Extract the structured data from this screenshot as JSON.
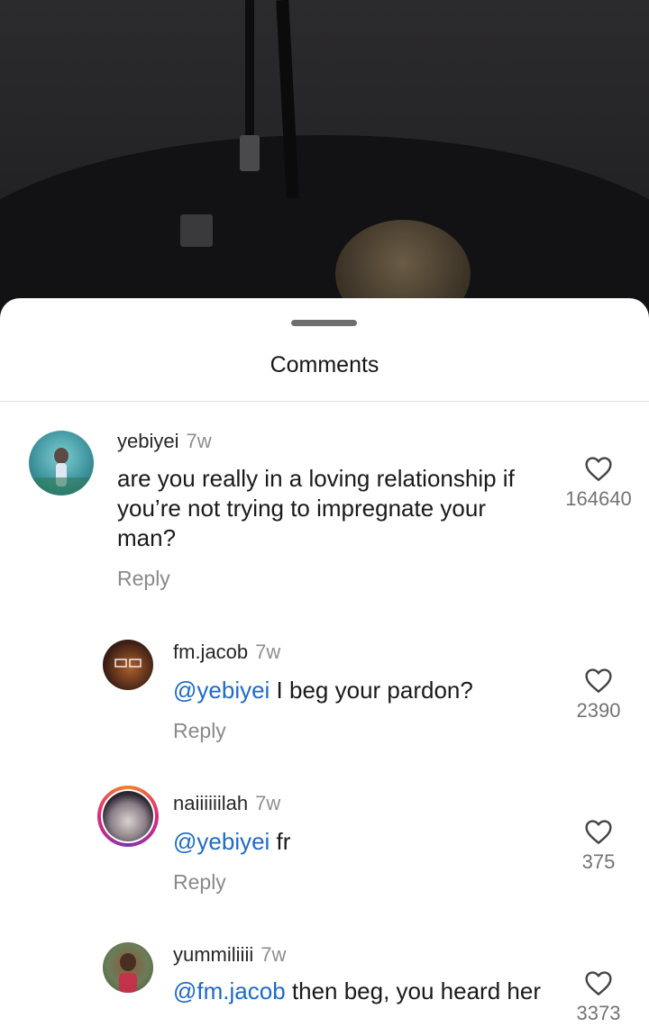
{
  "sheet": {
    "title": "Comments"
  },
  "comments": [
    {
      "user": "yebiyei",
      "time": "7w",
      "mention": "",
      "text": "are you really in a loving relationship if you’re not trying to impregnate your man?",
      "reply_label": "Reply",
      "likes": "164640"
    },
    {
      "user": "fm.jacob",
      "time": "7w",
      "mention": "@yebiyei",
      "text": " I beg your pardon?",
      "reply_label": "Reply",
      "likes": "2390"
    },
    {
      "user": "naiiiiiilah",
      "time": "7w",
      "mention": "@yebiyei",
      "text": " fr",
      "reply_label": "Reply",
      "likes": "375"
    },
    {
      "user": "yummiliiii",
      "time": "7w",
      "mention": "@fm.jacob",
      "text": " then beg, you heard her",
      "reply_label": "",
      "likes": "3373"
    }
  ],
  "colors": {
    "mention": "#1e6bc5",
    "story_ring": "#d62976"
  },
  "icons": {
    "like": "heart-outline-icon"
  }
}
